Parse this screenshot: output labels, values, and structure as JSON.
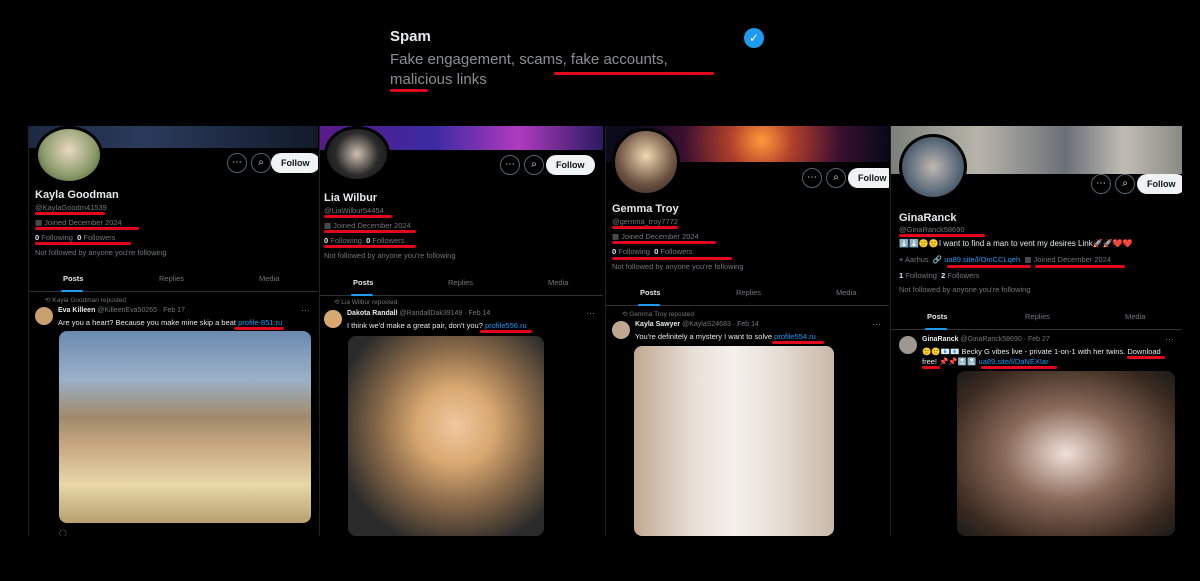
{
  "banner": {
    "title": "Spam",
    "description": "Fake engagement, scams, fake accounts, malicious links",
    "check_icon": "checkmark-circle-icon",
    "accent": "#1d9bf0",
    "underline_color": "#e0081b"
  },
  "profiles": [
    {
      "name": "Kayla Goodman",
      "handle": "@KaylaGoodm41539",
      "joined": "Joined December 2024",
      "following_count": "0",
      "following_label": "Following",
      "followers_count": "0",
      "followers_label": "Followers",
      "not_followed": "Not followed by anyone you're following",
      "follow_label": "Follow",
      "tabs": [
        "Posts",
        "Replies",
        "Media"
      ],
      "repost_label": "Kayla Goodman reposted",
      "post_name": "Eva Killeen",
      "post_meta": "@KilleenEva50265 · Feb 17",
      "post_text": "Are you a heart? Because you make mine skip a beat",
      "post_link": "profile-851.ru"
    },
    {
      "name": "Lia Wilbur",
      "handle": "@LiaWilbur54454",
      "joined": "Joined December 2024",
      "following_count": "0",
      "following_label": "Following",
      "followers_count": "0",
      "followers_label": "Followers",
      "not_followed": "Not followed by anyone you're following",
      "follow_label": "Follow",
      "tabs": [
        "Posts",
        "Replies",
        "Media"
      ],
      "repost_label": "Lia Wilbur reposted",
      "post_name": "Dakota Randall",
      "post_meta": "@RandallDak39149 · Feb 14",
      "post_text": "I think we'd make a great pair, don't you?",
      "post_link": "profile556.ru"
    },
    {
      "name": "Gemma Troy",
      "handle": "@gemma_troy7772",
      "joined": "Joined December 2024",
      "following_count": "0",
      "following_label": "Following",
      "followers_count": "0",
      "followers_label": "Followers",
      "not_followed": "Not followed by anyone you're following",
      "follow_label": "Follow",
      "tabs": [
        "Posts",
        "Replies",
        "Media"
      ],
      "repost_label": "Gemma Troy reposted",
      "post_name": "Kayla Sawyer",
      "post_meta": "@KaylaS24683 · Feb 14",
      "post_text": "You're definitely a mystery I want to solve",
      "post_link": "profile554.ru"
    },
    {
      "name": "GinaRanck",
      "handle": "@GinaRanck58690",
      "bio": "⬇️⬇️🙂🙂I want to find a man to vent my desires Link🚀🚀❤️❤️",
      "location": "Aarhus",
      "website": "ua89.site/l/OmCCLqeh",
      "joined": "Joined December 2024",
      "following_count": "1",
      "following_label": "Following",
      "followers_count": "2",
      "followers_label": "Followers",
      "not_followed": "Not followed by anyone you're following",
      "follow_label": "Follow",
      "tabs": [
        "Posts",
        "Replies",
        "Media"
      ],
      "post_name": "GinaRanck",
      "post_meta": "@GinaRanck58690 · Feb 27",
      "post_text": "🙂🙂📧📧 Becky G vibes live - private 1-on-1 with her twins. Download free! 📌📌🔝🔝",
      "post_link": "ua89.site/l/DaNEXIar"
    }
  ]
}
